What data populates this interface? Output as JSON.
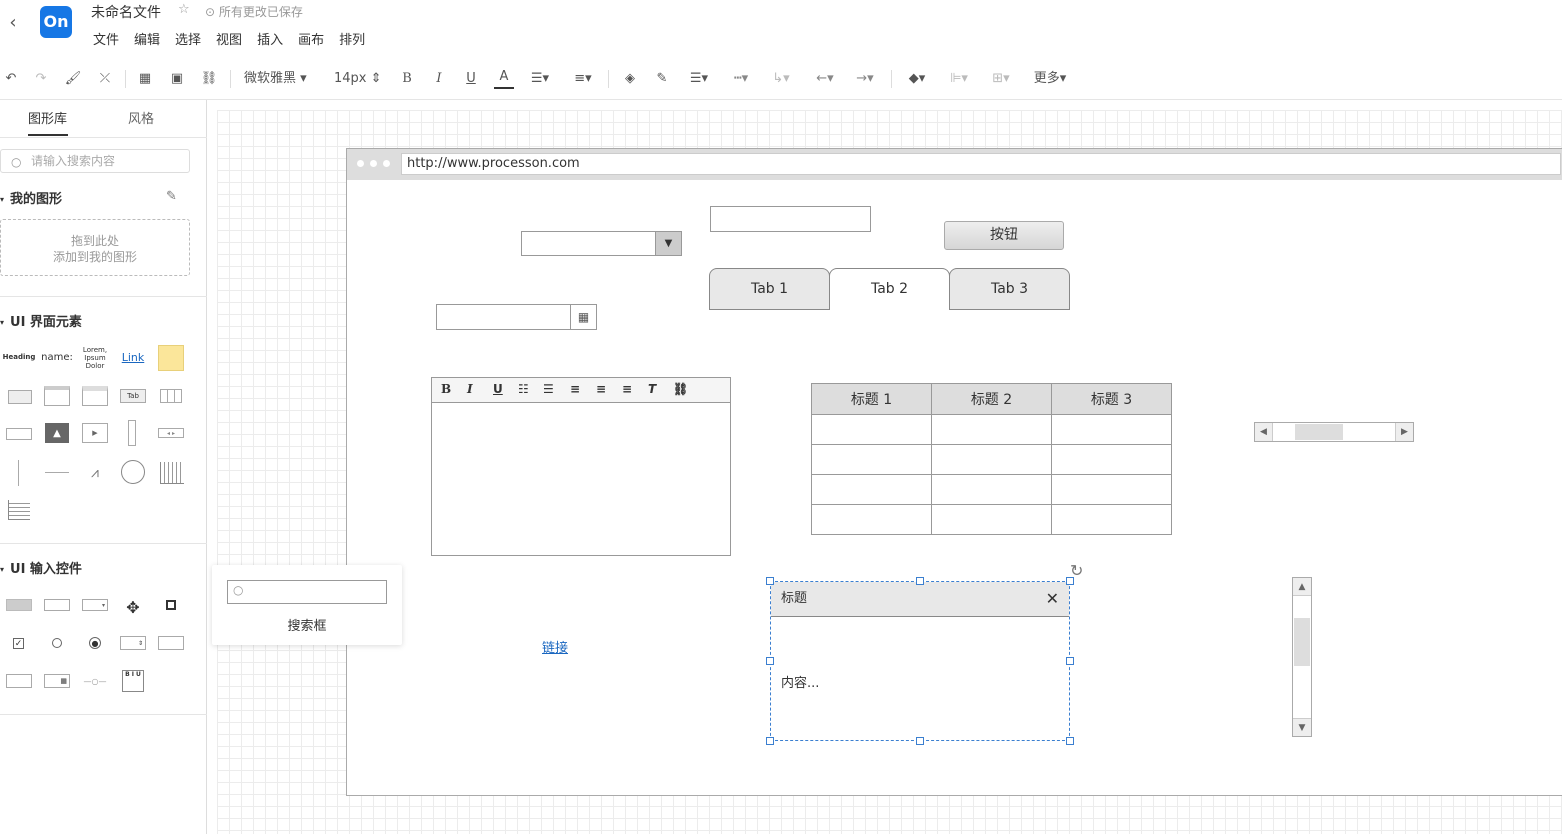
{
  "header": {
    "title": "未命名文件",
    "save_status": "所有更改已保存",
    "logo_text": "On",
    "menu": [
      "文件",
      "编辑",
      "选择",
      "视图",
      "插入",
      "画布",
      "排列"
    ]
  },
  "toolbar": {
    "font_family": "微软雅黑",
    "font_size": "14px",
    "more": "更多"
  },
  "sidebar": {
    "tabs": [
      "图形库",
      "风格"
    ],
    "search_placeholder": "请输入搜索内容",
    "my_shapes": {
      "title": "我的图形",
      "dropzone_line1": "拖到此处",
      "dropzone_line2": "添加到我的图形"
    },
    "ui_elements": {
      "title": "UI 界面元素",
      "samples": [
        "Heading",
        "name:",
        "Lorem, Ipsum Dolor",
        "Link",
        "Tab"
      ]
    },
    "ui_inputs": {
      "title": "UI 输入控件"
    }
  },
  "canvas": {
    "browser_url": "http://www.processon.com",
    "button_label": "按钮",
    "tabs": [
      "Tab 1",
      "Tab 2",
      "Tab 3"
    ],
    "active_tab": 1,
    "table_headers": [
      "标题 1",
      "标题 2",
      "标题 3"
    ],
    "link_text": "链接",
    "dialog_title": "标题",
    "dialog_content": "内容...",
    "popup_label": "搜索框",
    "richtext_buttons": [
      "B",
      "I",
      "U"
    ]
  }
}
